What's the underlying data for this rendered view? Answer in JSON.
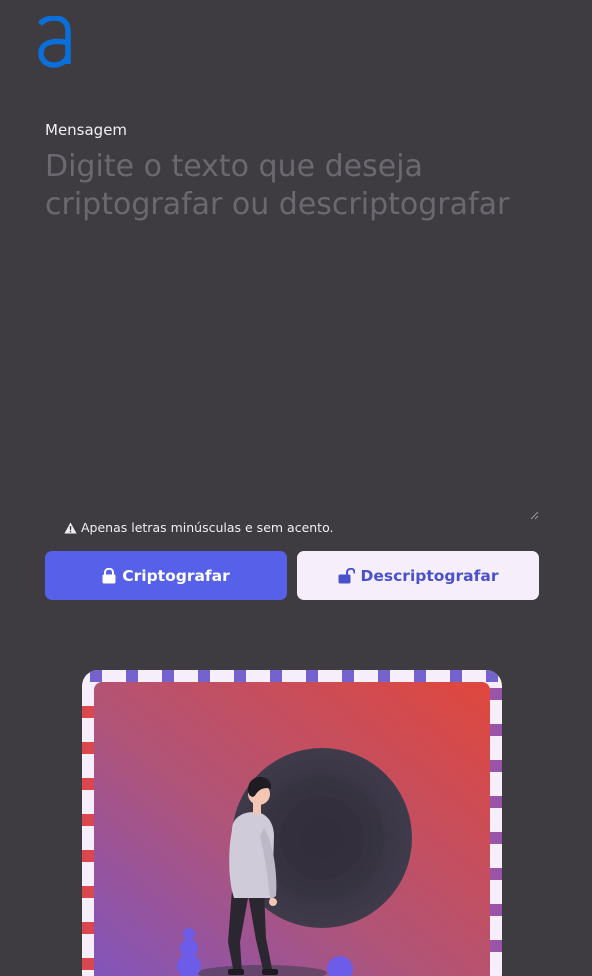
{
  "brand": {
    "logo_letter": "a",
    "color": "#0a6fd8"
  },
  "form": {
    "label": "Mensagem",
    "placeholder": "Digite o texto que deseja criptografar ou descriptografar",
    "value": ""
  },
  "hint": {
    "icon": "warning-icon",
    "text": "Apenas letras minúsculas e sem acento."
  },
  "actions": {
    "encrypt": {
      "label": "Criptografar",
      "icon": "lock-icon",
      "color": "#5660e8"
    },
    "decrypt": {
      "label": "Descriptografar",
      "icon": "unlock-icon",
      "color": "#f6eefb"
    }
  },
  "illustration": {
    "name": "person-looking-at-dark-circle"
  },
  "colors": {
    "background": "#3e3c40",
    "text": "#f1eef4",
    "placeholder": "#6b6870"
  }
}
